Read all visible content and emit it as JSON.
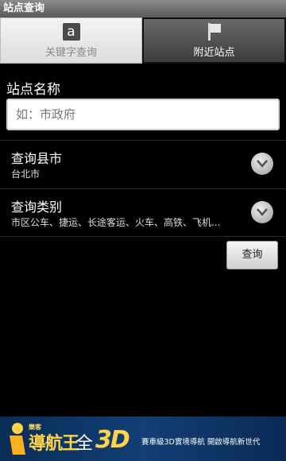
{
  "titlebar": {
    "title": "站点查询"
  },
  "tabs": [
    {
      "label": "关键字查询",
      "icon": "a-letter-icon",
      "active": true
    },
    {
      "label": "附近站点",
      "icon": "flag-icon",
      "active": false
    }
  ],
  "station": {
    "label": "站点名称",
    "placeholder": "如：市政府",
    "value": ""
  },
  "city": {
    "label": "查询县市",
    "value": "台北市"
  },
  "category": {
    "label": "查询类别",
    "value": "市区公车、捷运、长途客运、火车、高铁、飞机..."
  },
  "search_button": {
    "label": "查询"
  },
  "ad": {
    "small": "樂客",
    "brand": "導航王",
    "quan": "全",
    "three_d": "3D",
    "slogan": "賽車級3D實境導航 開啟導航新世代"
  }
}
